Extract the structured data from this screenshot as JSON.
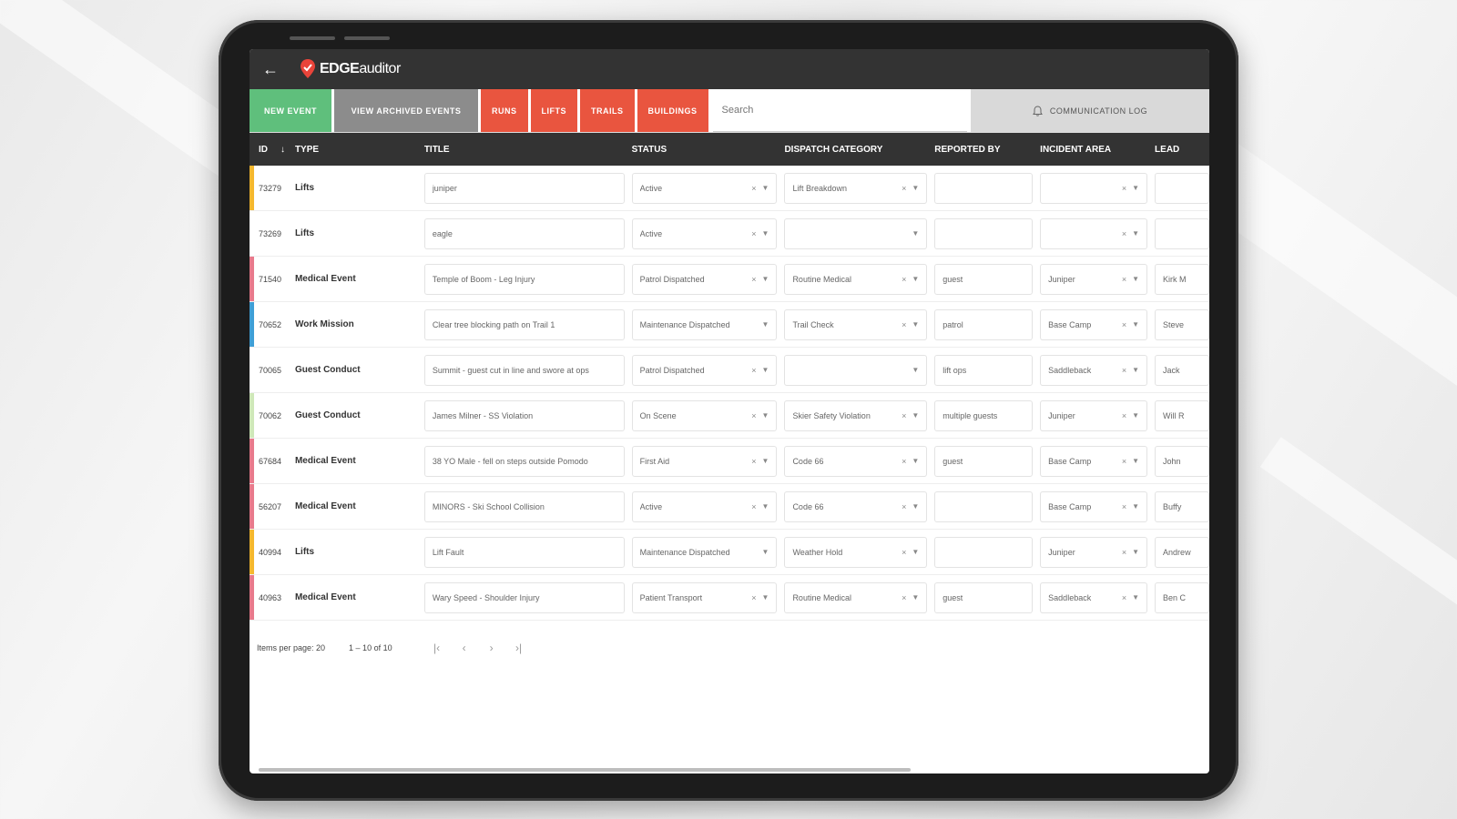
{
  "app": {
    "brand_bold": "EDGE",
    "brand_light": "auditor"
  },
  "toolbar": {
    "new_event": "NEW EVENT",
    "view_archived": "VIEW ARCHIVED EVENTS",
    "runs": "RUNS",
    "lifts": "LIFTS",
    "trails": "TRAILS",
    "buildings": "BUILDINGS",
    "search_placeholder": "Search",
    "communication_log": "COMMUNICATION LOG"
  },
  "table": {
    "headers": {
      "id": "ID",
      "type": "TYPE",
      "title": "TITLE",
      "status": "STATUS",
      "dispatch_category": "DISPATCH CATEGORY",
      "reported_by": "REPORTED BY",
      "incident_area": "INCIDENT AREA",
      "lead": "LEAD"
    },
    "rows": [
      {
        "id": "73279",
        "type": "Lifts",
        "color": "#f5b82e",
        "title": "juniper",
        "status": "Active",
        "dispatch": "Lift Breakdown",
        "reported_by": "",
        "area": "",
        "lead": ""
      },
      {
        "id": "73269",
        "type": "Lifts",
        "color": "#ffffff",
        "title": "eagle",
        "status": "Active",
        "dispatch": "",
        "reported_by": "",
        "area": "",
        "lead": ""
      },
      {
        "id": "71540",
        "type": "Medical Event",
        "color": "#e87a8c",
        "title": "Temple of Boom - Leg Injury",
        "status": "Patrol Dispatched",
        "dispatch": "Routine Medical",
        "reported_by": "guest",
        "area": "Juniper",
        "lead": "Kirk M"
      },
      {
        "id": "70652",
        "type": "Work Mission",
        "color": "#3f9fd6",
        "title": "Clear tree blocking path on Trail 1",
        "status": "Maintenance Dispatched",
        "dispatch": "Trail Check",
        "reported_by": "patrol",
        "area": "Base Camp",
        "lead": "Steve"
      },
      {
        "id": "70065",
        "type": "Guest Conduct",
        "color": "#ffffff",
        "title": "Summit - guest cut in line and swore at ops",
        "status": "Patrol Dispatched",
        "dispatch": "",
        "reported_by": "lift ops",
        "area": "Saddleback",
        "lead": "Jack"
      },
      {
        "id": "70062",
        "type": "Guest Conduct",
        "color": "#cfe8b9",
        "title": "James Milner - SS Violation",
        "status": "On Scene",
        "dispatch": "Skier Safety Violation",
        "reported_by": "multiple guests",
        "area": "Juniper",
        "lead": "Will R"
      },
      {
        "id": "67684",
        "type": "Medical Event",
        "color": "#e87a8c",
        "title": "38 YO Male - fell on steps outside Pomodo",
        "status": "First Aid",
        "dispatch": "Code 66",
        "reported_by": "guest",
        "area": "Base Camp",
        "lead": "John"
      },
      {
        "id": "56207",
        "type": "Medical Event",
        "color": "#e87a8c",
        "title": "MINORS - Ski School Collision",
        "status": "Active",
        "dispatch": "Code 66",
        "reported_by": "",
        "area": "Base Camp",
        "lead": "Buffy"
      },
      {
        "id": "40994",
        "type": "Lifts",
        "color": "#f5b82e",
        "title": "Lift Fault",
        "status": "Maintenance Dispatched",
        "dispatch": "Weather Hold",
        "reported_by": "",
        "area": "Juniper",
        "lead": "Andrew"
      },
      {
        "id": "40963",
        "type": "Medical Event",
        "color": "#e87a8c",
        "title": "Wary Speed - Shoulder Injury",
        "status": "Patient Transport",
        "dispatch": "Routine Medical",
        "reported_by": "guest",
        "area": "Saddleback",
        "lead": "Ben C"
      }
    ]
  },
  "pager": {
    "items_per_page": "Items per page: 20",
    "range": "1 – 10 of 10"
  },
  "colors": {
    "green": "#5fbf7c",
    "gray": "#8c8c8c",
    "red": "#e9553f",
    "header": "#333333"
  },
  "icons": [
    "back-arrow-icon",
    "edge-logo-icon",
    "bell-icon",
    "sort-arrow-icon",
    "clear-icon",
    "dropdown-icon",
    "first-page-icon",
    "prev-page-icon",
    "next-page-icon",
    "last-page-icon"
  ]
}
